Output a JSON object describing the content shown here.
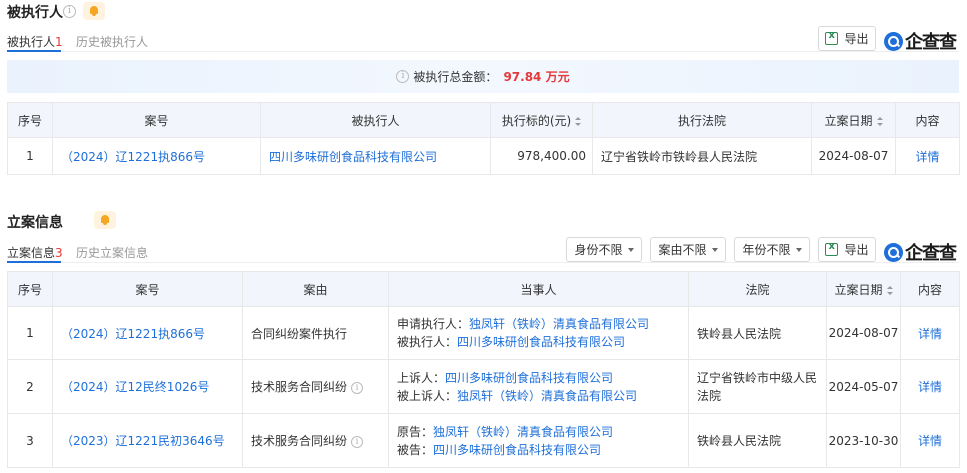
{
  "section1": {
    "title": "被执行人",
    "tabs": [
      {
        "label": "被执行人",
        "count": "1"
      },
      {
        "label": "历史被执行人"
      }
    ],
    "export_label": "导出",
    "logo_text": "企查查",
    "banner": {
      "label": "被执行总金额：",
      "amount": "97.84 万元"
    },
    "table": {
      "headers": [
        "序号",
        "案号",
        "被执行人",
        "执行标的(元)",
        "执行法院",
        "立案日期",
        "内容"
      ],
      "rows": [
        {
          "index": "1",
          "case_no": "（2024）辽1221执866号",
          "party": "四川多味研创食品科技有限公司",
          "amount": "978,400.00",
          "court": "辽宁省铁岭市铁岭县人民法院",
          "date": "2024-08-07",
          "detail": "详情"
        }
      ]
    }
  },
  "section2": {
    "title": "立案信息",
    "tabs": [
      {
        "label": "立案信息",
        "count": "3"
      },
      {
        "label": "历史立案信息"
      }
    ],
    "filters": [
      "身份不限",
      "案由不限",
      "年份不限"
    ],
    "export_label": "导出",
    "logo_text": "企查查",
    "table": {
      "headers": [
        "序号",
        "案号",
        "案由",
        "当事人",
        "法院",
        "立案日期",
        "内容"
      ],
      "rows": [
        {
          "index": "1",
          "case_no": "（2024）辽1221执866号",
          "cause": "合同纠纷案件执行",
          "parties": [
            {
              "role": "申请执行人：",
              "name": "独凤轩（铁岭）清真食品有限公司"
            },
            {
              "role": "被执行人：",
              "name": "四川多味研创食品科技有限公司"
            }
          ],
          "court": "铁岭县人民法院",
          "date": "2024-08-07",
          "detail": "详情"
        },
        {
          "index": "2",
          "case_no": "（2024）辽12民终1026号",
          "cause": "技术服务合同纠纷",
          "parties": [
            {
              "role": "上诉人：",
              "name": "四川多味研创食品科技有限公司"
            },
            {
              "role": "被上诉人：",
              "name": "独凤轩（铁岭）清真食品有限公司"
            }
          ],
          "court": "辽宁省铁岭市中级人民法院",
          "date": "2024-05-07",
          "detail": "详情"
        },
        {
          "index": "3",
          "case_no": "（2023）辽1221民初3646号",
          "cause": "技术服务合同纠纷",
          "parties": [
            {
              "role": "原告：",
              "name": "独凤轩（铁岭）清真食品有限公司"
            },
            {
              "role": "被告：",
              "name": "四川多味研创食品科技有限公司"
            }
          ],
          "court": "铁岭县人民法院",
          "date": "2023-10-30",
          "detail": "详情"
        }
      ]
    }
  },
  "colors": {
    "accent": "#1e6fd9",
    "danger": "#e4393c",
    "header_bg": "#f2f6fc"
  }
}
